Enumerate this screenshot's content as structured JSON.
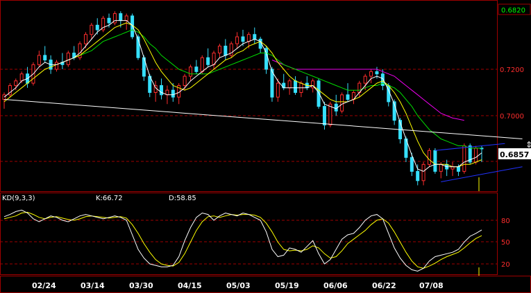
{
  "chart_data": [
    {
      "type": "candlestick",
      "panel": "price",
      "y_ticks": [
        "0.6820",
        "0.7200",
        "0.7000",
        "0.6857"
      ],
      "y_tick_values": [
        0.72,
        0.7,
        0.6857
      ],
      "top_label": "0.6820",
      "ylim": [
        0.668,
        0.748
      ],
      "last_price": "0.6857",
      "x_labels": [
        "02/24",
        "03/14",
        "03/30",
        "04/15",
        "05/03",
        "05/19",
        "06/06",
        "06/22",
        "07/08"
      ],
      "candles": [
        [
          0.707,
          0.71,
          0.703,
          0.709
        ],
        [
          0.709,
          0.714,
          0.708,
          0.713
        ],
        [
          0.713,
          0.716,
          0.711,
          0.715
        ],
        [
          0.715,
          0.719,
          0.714,
          0.718
        ],
        [
          0.718,
          0.721,
          0.712,
          0.714
        ],
        [
          0.714,
          0.723,
          0.713,
          0.722
        ],
        [
          0.722,
          0.728,
          0.721,
          0.726
        ],
        [
          0.726,
          0.73,
          0.723,
          0.724
        ],
        [
          0.724,
          0.726,
          0.718,
          0.72
        ],
        [
          0.72,
          0.724,
          0.719,
          0.723
        ],
        [
          0.723,
          0.727,
          0.72,
          0.722
        ],
        [
          0.722,
          0.728,
          0.721,
          0.727
        ],
        [
          0.727,
          0.73,
          0.724,
          0.725
        ],
        [
          0.725,
          0.732,
          0.724,
          0.731
        ],
        [
          0.731,
          0.736,
          0.729,
          0.735
        ],
        [
          0.735,
          0.74,
          0.733,
          0.739
        ],
        [
          0.739,
          0.742,
          0.735,
          0.737
        ],
        [
          0.737,
          0.743,
          0.736,
          0.742
        ],
        [
          0.742,
          0.744,
          0.738,
          0.74
        ],
        [
          0.74,
          0.745,
          0.739,
          0.744
        ],
        [
          0.744,
          0.745,
          0.738,
          0.741
        ],
        [
          0.741,
          0.744,
          0.737,
          0.743
        ],
        [
          0.743,
          0.744,
          0.733,
          0.734
        ],
        [
          0.734,
          0.735,
          0.724,
          0.725
        ],
        [
          0.725,
          0.726,
          0.715,
          0.717
        ],
        [
          0.717,
          0.718,
          0.708,
          0.71
        ],
        [
          0.71,
          0.715,
          0.706,
          0.713
        ],
        [
          0.713,
          0.716,
          0.707,
          0.709
        ],
        [
          0.709,
          0.713,
          0.705,
          0.711
        ],
        [
          0.711,
          0.714,
          0.706,
          0.708
        ],
        [
          0.708,
          0.714,
          0.705,
          0.713
        ],
        [
          0.713,
          0.718,
          0.711,
          0.717
        ],
        [
          0.717,
          0.722,
          0.715,
          0.721
        ],
        [
          0.721,
          0.724,
          0.718,
          0.719
        ],
        [
          0.719,
          0.726,
          0.718,
          0.725
        ],
        [
          0.725,
          0.729,
          0.721,
          0.722
        ],
        [
          0.722,
          0.728,
          0.72,
          0.727
        ],
        [
          0.727,
          0.731,
          0.725,
          0.73
        ],
        [
          0.73,
          0.733,
          0.724,
          0.726
        ],
        [
          0.726,
          0.732,
          0.725,
          0.731
        ],
        [
          0.731,
          0.736,
          0.729,
          0.734
        ],
        [
          0.734,
          0.737,
          0.73,
          0.732
        ],
        [
          0.732,
          0.736,
          0.729,
          0.735
        ],
        [
          0.735,
          0.738,
          0.731,
          0.733
        ],
        [
          0.733,
          0.734,
          0.727,
          0.729
        ],
        [
          0.729,
          0.73,
          0.718,
          0.72
        ],
        [
          0.72,
          0.721,
          0.706,
          0.708
        ],
        [
          0.708,
          0.716,
          0.706,
          0.714
        ],
        [
          0.714,
          0.718,
          0.711,
          0.712
        ],
        [
          0.712,
          0.716,
          0.709,
          0.715
        ],
        [
          0.715,
          0.717,
          0.709,
          0.71
        ],
        [
          0.71,
          0.715,
          0.708,
          0.714
        ],
        [
          0.714,
          0.717,
          0.711,
          0.712
        ],
        [
          0.712,
          0.716,
          0.71,
          0.715
        ],
        [
          0.715,
          0.716,
          0.703,
          0.704
        ],
        [
          0.704,
          0.706,
          0.694,
          0.696
        ],
        [
          0.696,
          0.706,
          0.695,
          0.705
        ],
        [
          0.705,
          0.709,
          0.7,
          0.702
        ],
        [
          0.702,
          0.71,
          0.701,
          0.709
        ],
        [
          0.709,
          0.714,
          0.706,
          0.707
        ],
        [
          0.707,
          0.711,
          0.705,
          0.71
        ],
        [
          0.71,
          0.715,
          0.708,
          0.714
        ],
        [
          0.714,
          0.718,
          0.711,
          0.717
        ],
        [
          0.717,
          0.72,
          0.714,
          0.719
        ],
        [
          0.719,
          0.721,
          0.716,
          0.718
        ],
        [
          0.718,
          0.72,
          0.711,
          0.713
        ],
        [
          0.713,
          0.714,
          0.704,
          0.706
        ],
        [
          0.706,
          0.707,
          0.696,
          0.698
        ],
        [
          0.698,
          0.699,
          0.688,
          0.69
        ],
        [
          0.69,
          0.691,
          0.68,
          0.682
        ],
        [
          0.682,
          0.684,
          0.674,
          0.676
        ],
        [
          0.676,
          0.679,
          0.67,
          0.672
        ],
        [
          0.672,
          0.68,
          0.67,
          0.679
        ],
        [
          0.679,
          0.686,
          0.678,
          0.685
        ],
        [
          0.685,
          0.686,
          0.675,
          0.676
        ],
        [
          0.676,
          0.68,
          0.673,
          0.679
        ],
        [
          0.679,
          0.681,
          0.674,
          0.677
        ],
        [
          0.677,
          0.68,
          0.674,
          0.678
        ],
        [
          0.678,
          0.679,
          0.674,
          0.676
        ],
        [
          0.676,
          0.688,
          0.675,
          0.687
        ],
        [
          0.687,
          0.688,
          0.679,
          0.68
        ],
        [
          0.68,
          0.687,
          0.679,
          0.686
        ],
        [
          0.686,
          0.687,
          0.68,
          0.6857
        ]
      ],
      "ma_fast": [
        0.708,
        0.71,
        0.712,
        0.715,
        0.716,
        0.718,
        0.721,
        0.723,
        0.722,
        0.722,
        0.723,
        0.724,
        0.725,
        0.727,
        0.73,
        0.733,
        0.736,
        0.738,
        0.739,
        0.741,
        0.741,
        0.741,
        0.739,
        0.733,
        0.725,
        0.717,
        0.712,
        0.71,
        0.709,
        0.709,
        0.71,
        0.712,
        0.715,
        0.717,
        0.719,
        0.721,
        0.722,
        0.725,
        0.726,
        0.727,
        0.729,
        0.731,
        0.732,
        0.733,
        0.732,
        0.727,
        0.719,
        0.715,
        0.712,
        0.712,
        0.712,
        0.712,
        0.712,
        0.713,
        0.71,
        0.705,
        0.704,
        0.703,
        0.705,
        0.706,
        0.707,
        0.71,
        0.713,
        0.716,
        0.717,
        0.716,
        0.711,
        0.705,
        0.697,
        0.69,
        0.683,
        0.677,
        0.676,
        0.678,
        0.679,
        0.679,
        0.678,
        0.678,
        0.678,
        0.68,
        0.681,
        0.682,
        0.684
      ],
      "ma_mid": [
        0.706,
        0.708,
        0.71,
        0.712,
        0.714,
        0.716,
        0.718,
        0.72,
        0.721,
        0.722,
        0.723,
        0.724,
        0.725,
        0.726,
        0.728,
        0.73,
        0.732,
        0.734,
        0.736,
        0.738,
        0.739,
        0.74,
        0.739,
        0.737,
        0.733,
        0.728,
        0.723,
        0.719,
        0.716,
        0.713,
        0.712,
        0.711,
        0.712,
        0.714,
        0.716,
        0.718,
        0.72,
        0.722,
        0.724,
        0.725,
        0.727,
        0.728,
        0.73,
        0.731,
        0.732,
        0.73,
        0.727,
        0.723,
        0.72,
        0.717,
        0.715,
        0.714,
        0.713,
        0.713,
        0.711,
        0.709,
        0.707,
        0.706,
        0.706,
        0.706,
        0.707,
        0.708,
        0.71,
        0.712,
        0.714,
        0.715,
        0.713,
        0.71,
        0.706,
        0.701,
        0.695,
        0.689,
        0.684,
        0.681,
        0.679,
        0.679,
        0.679,
        0.678,
        0.678,
        0.679,
        0.679,
        0.68,
        0.681
      ],
      "ma_slow": [
        null,
        null,
        null,
        null,
        null,
        null,
        null,
        null,
        null,
        null,
        null,
        null,
        0.725,
        0.726,
        0.727,
        0.728,
        0.73,
        0.732,
        0.733,
        0.734,
        0.735,
        0.736,
        0.737,
        0.736,
        0.734,
        0.731,
        0.729,
        0.726,
        0.724,
        0.722,
        0.72,
        0.719,
        0.718,
        0.718,
        0.718,
        0.718,
        0.719,
        0.72,
        0.721,
        0.722,
        0.723,
        0.724,
        0.725,
        0.726,
        0.727,
        0.727,
        0.726,
        0.724,
        0.722,
        0.721,
        0.72,
        0.719,
        0.718,
        0.717,
        0.716,
        0.715,
        0.714,
        0.713,
        0.712,
        0.711,
        0.711,
        0.711,
        0.712,
        0.713,
        0.713,
        0.714,
        0.713,
        0.712,
        0.71,
        0.707,
        0.704,
        0.7,
        0.697,
        0.694,
        0.692,
        0.69,
        0.689,
        0.688,
        0.687,
        0.687,
        0.686,
        0.686,
        0.686
      ],
      "ma_long": [
        null,
        null,
        null,
        null,
        null,
        null,
        null,
        null,
        null,
        null,
        null,
        null,
        null,
        null,
        null,
        null,
        null,
        null,
        null,
        null,
        null,
        null,
        null,
        null,
        null,
        null,
        null,
        null,
        null,
        null,
        null,
        null,
        null,
        null,
        null,
        null,
        null,
        null,
        null,
        null,
        null,
        null,
        null,
        null,
        null,
        null,
        0.724,
        0.723,
        0.722,
        0.721,
        0.72,
        0.72,
        0.72,
        0.72,
        0.72,
        0.72,
        0.72,
        0.72,
        0.72,
        0.72,
        0.72,
        0.72,
        0.72,
        0.72,
        0.72,
        0.719,
        0.718,
        0.717,
        0.715,
        0.713,
        0.711,
        0.709,
        0.707,
        0.705,
        0.703,
        0.701,
        0.7,
        0.699,
        0.6985,
        0.698,
        null,
        null,
        null
      ],
      "trendlines": [
        {
          "color": "#ffffff",
          "from": [
            0,
            0.707
          ],
          "to": [
            86,
            0.69
          ]
        },
        {
          "color": "#2233ff",
          "from": [
            74,
            0.685
          ],
          "to": [
            83,
            0.688
          ]
        },
        {
          "color": "#2233ff",
          "from": [
            75,
            0.6715
          ],
          "to": [
            86,
            0.678
          ]
        }
      ]
    },
    {
      "type": "line",
      "panel": "kd",
      "title": "KD(9,3,3)",
      "k_label": "K:66.72",
      "d_label": "D:58.85",
      "ylim": [
        0,
        100
      ],
      "y_ticks": [
        "80",
        "50",
        "20"
      ],
      "y_tick_values": [
        80,
        50,
        20
      ],
      "series": [
        {
          "name": "K",
          "values": [
            85,
            88,
            92,
            94,
            90,
            82,
            78,
            82,
            86,
            84,
            80,
            78,
            82,
            86,
            88,
            86,
            84,
            82,
            84,
            86,
            84,
            80,
            60,
            40,
            28,
            20,
            18,
            16,
            16,
            18,
            30,
            52,
            70,
            84,
            90,
            88,
            80,
            86,
            90,
            88,
            86,
            90,
            88,
            84,
            80,
            64,
            40,
            30,
            32,
            42,
            40,
            36,
            44,
            52,
            34,
            20,
            26,
            40,
            54,
            60,
            62,
            70,
            80,
            86,
            88,
            82,
            62,
            42,
            28,
            18,
            12,
            10,
            14,
            24,
            30,
            32,
            34,
            36,
            40,
            50,
            58,
            62,
            66.72
          ]
        },
        {
          "name": "D",
          "values": [
            82,
            84,
            86,
            90,
            91,
            88,
            84,
            82,
            84,
            85,
            83,
            81,
            80,
            82,
            85,
            86,
            85,
            84,
            83,
            84,
            85,
            83,
            74,
            62,
            48,
            36,
            26,
            20,
            18,
            17,
            22,
            34,
            50,
            66,
            78,
            85,
            86,
            84,
            86,
            88,
            87,
            88,
            88,
            87,
            84,
            76,
            64,
            50,
            40,
            38,
            39,
            38,
            40,
            45,
            42,
            34,
            28,
            30,
            38,
            48,
            54,
            60,
            66,
            74,
            80,
            82,
            76,
            64,
            50,
            36,
            24,
            16,
            14,
            17,
            21,
            26,
            30,
            33,
            36,
            42,
            49,
            55,
            58.85
          ]
        }
      ]
    }
  ],
  "colors": {
    "background": "#000000",
    "frame": "#a00000",
    "grid": "#a00000",
    "up_candle": "#ff2d2d",
    "down_candle": "#36e0ff",
    "ma_fast": "#ffffff",
    "ma_mid": "#ffff00",
    "ma_slow": "#00dd00",
    "ma_long": "#ee00ee",
    "k_line": "#ffffff",
    "d_line": "#ffff00",
    "price_tag_bg": "#ffffff",
    "price_tag_text": "#000000",
    "top_tag_text": "#00ff00"
  }
}
